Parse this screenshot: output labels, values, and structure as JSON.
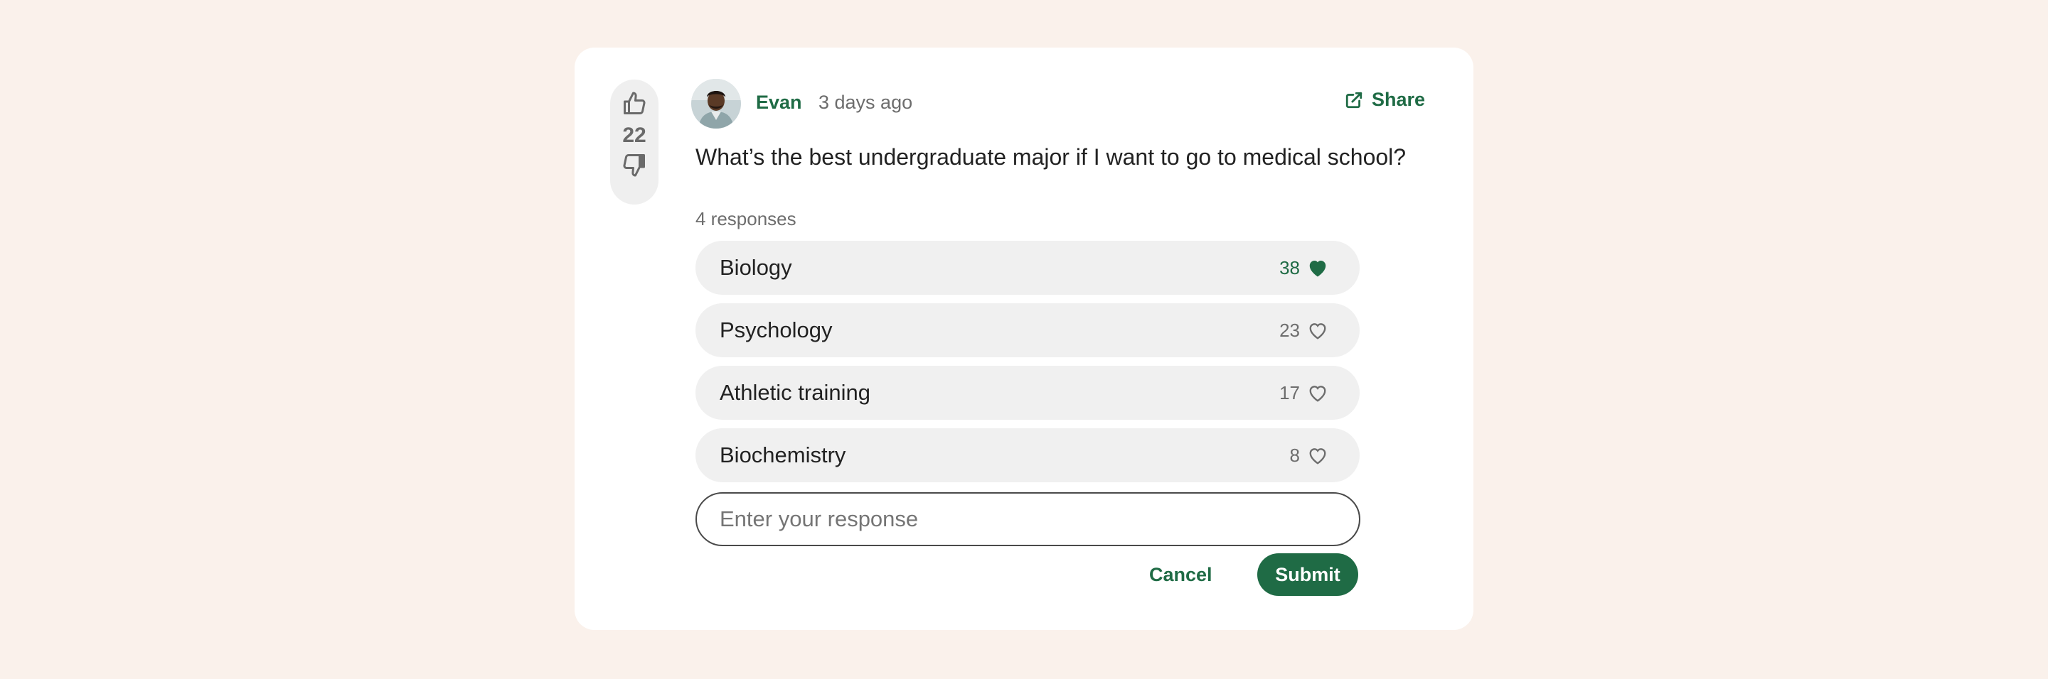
{
  "post": {
    "vote_count": "22",
    "author": "Evan",
    "time_ago": "3 days ago",
    "share_label": "Share",
    "question": "What’s the best undergraduate major if I want to go to medical school?",
    "responses_label": "4 responses"
  },
  "responses": [
    {
      "label": "Biology",
      "likes": "38",
      "liked": true
    },
    {
      "label": "Psychology",
      "likes": "23",
      "liked": false
    },
    {
      "label": "Athletic training",
      "likes": "17",
      "liked": false
    },
    {
      "label": "Biochemistry",
      "likes": "8",
      "liked": false
    }
  ],
  "form": {
    "input_value": "",
    "input_placeholder": "Enter your response",
    "cancel_label": "Cancel",
    "submit_label": "Submit"
  },
  "colors": {
    "accent": "#1f6b45",
    "page_background": "#faf1eb",
    "card_background": "#ffffff",
    "pill_background": "#f0f0f0"
  },
  "icons": {
    "upvote": "thumbs-up-icon",
    "downvote": "thumbs-down-icon",
    "share": "external-link-icon",
    "liked": "heart-filled-icon",
    "not_liked": "heart-outline-icon"
  }
}
